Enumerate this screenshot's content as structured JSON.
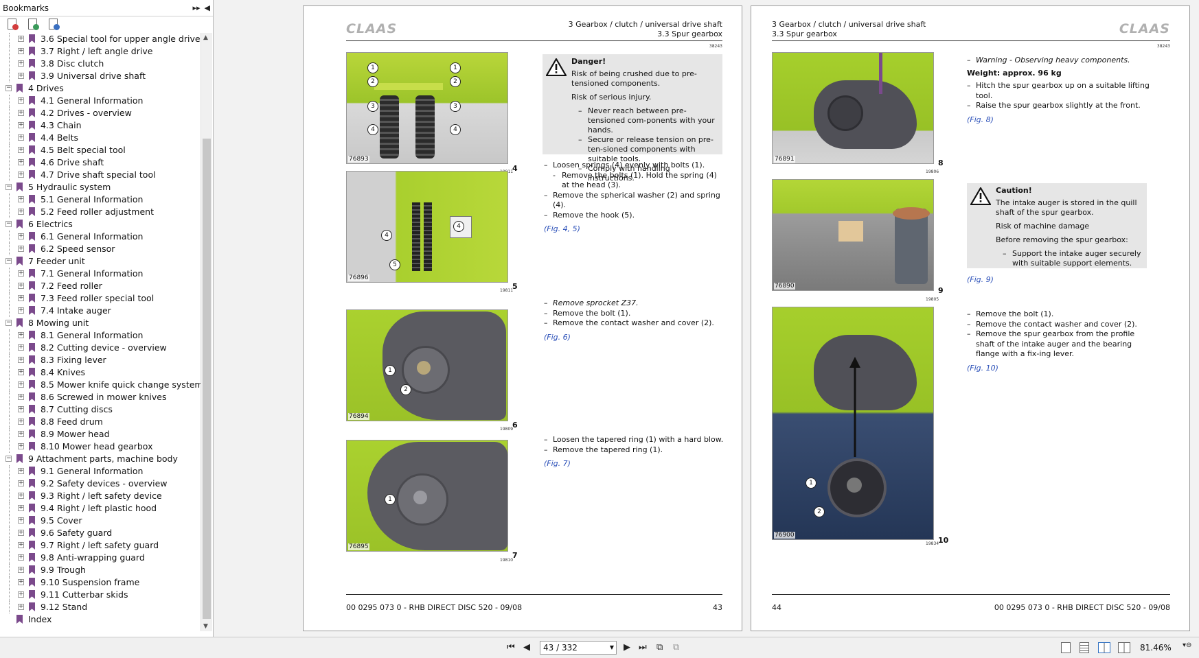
{
  "bookmarks": {
    "title": "Bookmarks",
    "items": [
      {
        "level": 2,
        "label": "3.6 Special tool for upper angle drive"
      },
      {
        "level": 2,
        "label": "3.7 Right / left angle drive"
      },
      {
        "level": 2,
        "label": "3.8 Disc clutch"
      },
      {
        "level": 2,
        "label": "3.9 Universal drive shaft"
      },
      {
        "level": 1,
        "label": "4 Drives"
      },
      {
        "level": 2,
        "label": "4.1 General Information"
      },
      {
        "level": 2,
        "label": "4.2 Drives - overview"
      },
      {
        "level": 2,
        "label": "4.3 Chain"
      },
      {
        "level": 2,
        "label": "4.4 Belts"
      },
      {
        "level": 2,
        "label": "4.5 Belt special tool"
      },
      {
        "level": 2,
        "label": "4.6 Drive shaft"
      },
      {
        "level": 2,
        "label": "4.7 Drive shaft special tool"
      },
      {
        "level": 1,
        "label": "5 Hydraulic system"
      },
      {
        "level": 2,
        "label": "5.1 General Information"
      },
      {
        "level": 2,
        "label": "5.2 Feed roller adjustment"
      },
      {
        "level": 1,
        "label": "6 Electrics"
      },
      {
        "level": 2,
        "label": "6.1 General Information"
      },
      {
        "level": 2,
        "label": "6.2 Speed sensor"
      },
      {
        "level": 1,
        "label": "7 Feeder unit"
      },
      {
        "level": 2,
        "label": "7.1 General Information"
      },
      {
        "level": 2,
        "label": "7.2 Feed roller"
      },
      {
        "level": 2,
        "label": "7.3 Feed roller special tool"
      },
      {
        "level": 2,
        "label": "7.4 Intake auger"
      },
      {
        "level": 1,
        "label": "8 Mowing unit"
      },
      {
        "level": 2,
        "label": "8.1 General Information"
      },
      {
        "level": 2,
        "label": "8.2 Cutting device - overview"
      },
      {
        "level": 2,
        "label": "8.3 Fixing lever"
      },
      {
        "level": 2,
        "label": "8.4 Knives"
      },
      {
        "level": 2,
        "label": "8.5 Mower knife quick change system"
      },
      {
        "level": 2,
        "label": "8.6 Screwed in mower knives"
      },
      {
        "level": 2,
        "label": "8.7 Cutting discs"
      },
      {
        "level": 2,
        "label": "8.8 Feed drum"
      },
      {
        "level": 2,
        "label": "8.9 Mower head"
      },
      {
        "level": 2,
        "label": "8.10 Mower head gearbox"
      },
      {
        "level": 1,
        "label": "9 Attachment parts, machine body"
      },
      {
        "level": 2,
        "label": "9.1 General Information"
      },
      {
        "level": 2,
        "label": "9.2 Safety devices - overview"
      },
      {
        "level": 2,
        "label": "9.3 Right / left safety device"
      },
      {
        "level": 2,
        "label": "9.4 Right / left plastic hood"
      },
      {
        "level": 2,
        "label": "9.5 Cover"
      },
      {
        "level": 2,
        "label": "9.6 Safety guard"
      },
      {
        "level": 2,
        "label": "9.7 Right / left safety guard"
      },
      {
        "level": 2,
        "label": "9.8 Anti-wrapping guard"
      },
      {
        "level": 2,
        "label": "9.9 Trough"
      },
      {
        "level": 2,
        "label": "9.10 Suspension frame"
      },
      {
        "level": 2,
        "label": "9.11 Cutterbar skids"
      },
      {
        "level": 2,
        "label": "9.12 Stand"
      },
      {
        "level": 1,
        "label": "Index",
        "leaf": true
      }
    ]
  },
  "page43": {
    "logo": "CLAAS",
    "header_line1": "3 Gearbox / clutch / universal drive shaft",
    "header_line2": "3.3 Spur gearbox",
    "docnum": "38243",
    "figures": [
      {
        "photo_no": "76893",
        "small": "19911",
        "fig": "4"
      },
      {
        "photo_no": "76896",
        "small": "19811",
        "fig": "5"
      },
      {
        "photo_no": "76894",
        "small": "19809",
        "fig": "6"
      },
      {
        "photo_no": "76895",
        "small": "19810",
        "fig": "7"
      }
    ],
    "danger": {
      "title": "Danger!",
      "line1": "Risk of being crushed due to pre-tensioned components.",
      "line2": "Risk of serious injury.",
      "b1": "Never reach between pre-tensioned com-ponents with your hands.",
      "b2": "Secure or release tension on pre-ten-sioned components with suitable tools.",
      "b3": "Comply with handling instructions."
    },
    "steps_a": {
      "s1": "Loosen springs (4) evenly with bolts (1).",
      "s1a": "Remove the bolts (1). Hold the spring (4) at the head (3).",
      "s2": "Remove the spherical washer (2) and spring (4).",
      "s3": "Remove the hook (5).",
      "ref": "(Fig. 4, 5)"
    },
    "steps_b": {
      "s1": "Remove sprocket Z37.",
      "s2": "Remove the bolt (1).",
      "s3": "Remove the contact washer and cover (2).",
      "ref": "(Fig. 6)"
    },
    "steps_c": {
      "s1": "Loosen the tapered ring (1) with a hard blow.",
      "s2": "Remove the tapered ring (1).",
      "ref": "(Fig. 7)"
    },
    "footer_left": "00 0295 073 0 - RHB DIRECT DISC 520 - 09/08",
    "footer_right": "43"
  },
  "page44": {
    "logo": "CLAAS",
    "header_line1": "3 Gearbox / clutch / universal drive shaft",
    "header_line2": "3.3 Spur gearbox",
    "docnum": "38243",
    "figures": [
      {
        "photo_no": "76891",
        "small": "19806",
        "fig": "8"
      },
      {
        "photo_no": "76890",
        "small": "19805",
        "fig": "9"
      },
      {
        "photo_no": "76900",
        "small": "19834",
        "fig": "10"
      }
    ],
    "warn_line": "Warning - Observing heavy components.",
    "weight": "Weight: approx. 96 kg",
    "steps_a": {
      "s1": "Hitch the spur gearbox up on a suitable lifting tool.",
      "s2": "Raise the spur gearbox slightly at the front.",
      "ref": "(Fig. 8)"
    },
    "caution": {
      "title": "Caution!",
      "line1": "The intake auger is stored in the quill shaft of the spur gearbox.",
      "line2": "Risk of machine damage",
      "line3": "Before removing the spur gearbox:",
      "b1": "Support the intake auger securely with suitable support elements."
    },
    "ref9": "(Fig. 9)",
    "steps_c": {
      "s1": "Remove the bolt (1).",
      "s2": "Remove the contact washer and cover (2).",
      "s3": "Remove the spur gearbox from the profile shaft of the intake auger and the bearing flange with a fix-ing lever.",
      "ref": "(Fig. 10)"
    },
    "footer_left": "44",
    "footer_right": "00 0295 073 0 - RHB DIRECT DISC 520 - 09/08"
  },
  "toolbar": {
    "page_field": "43 / 332",
    "zoom": "81.46%"
  },
  "colors": {
    "accent": "#7b4a8c",
    "claas_green": "#a8cf2a",
    "figref": "#2a4fb8"
  }
}
